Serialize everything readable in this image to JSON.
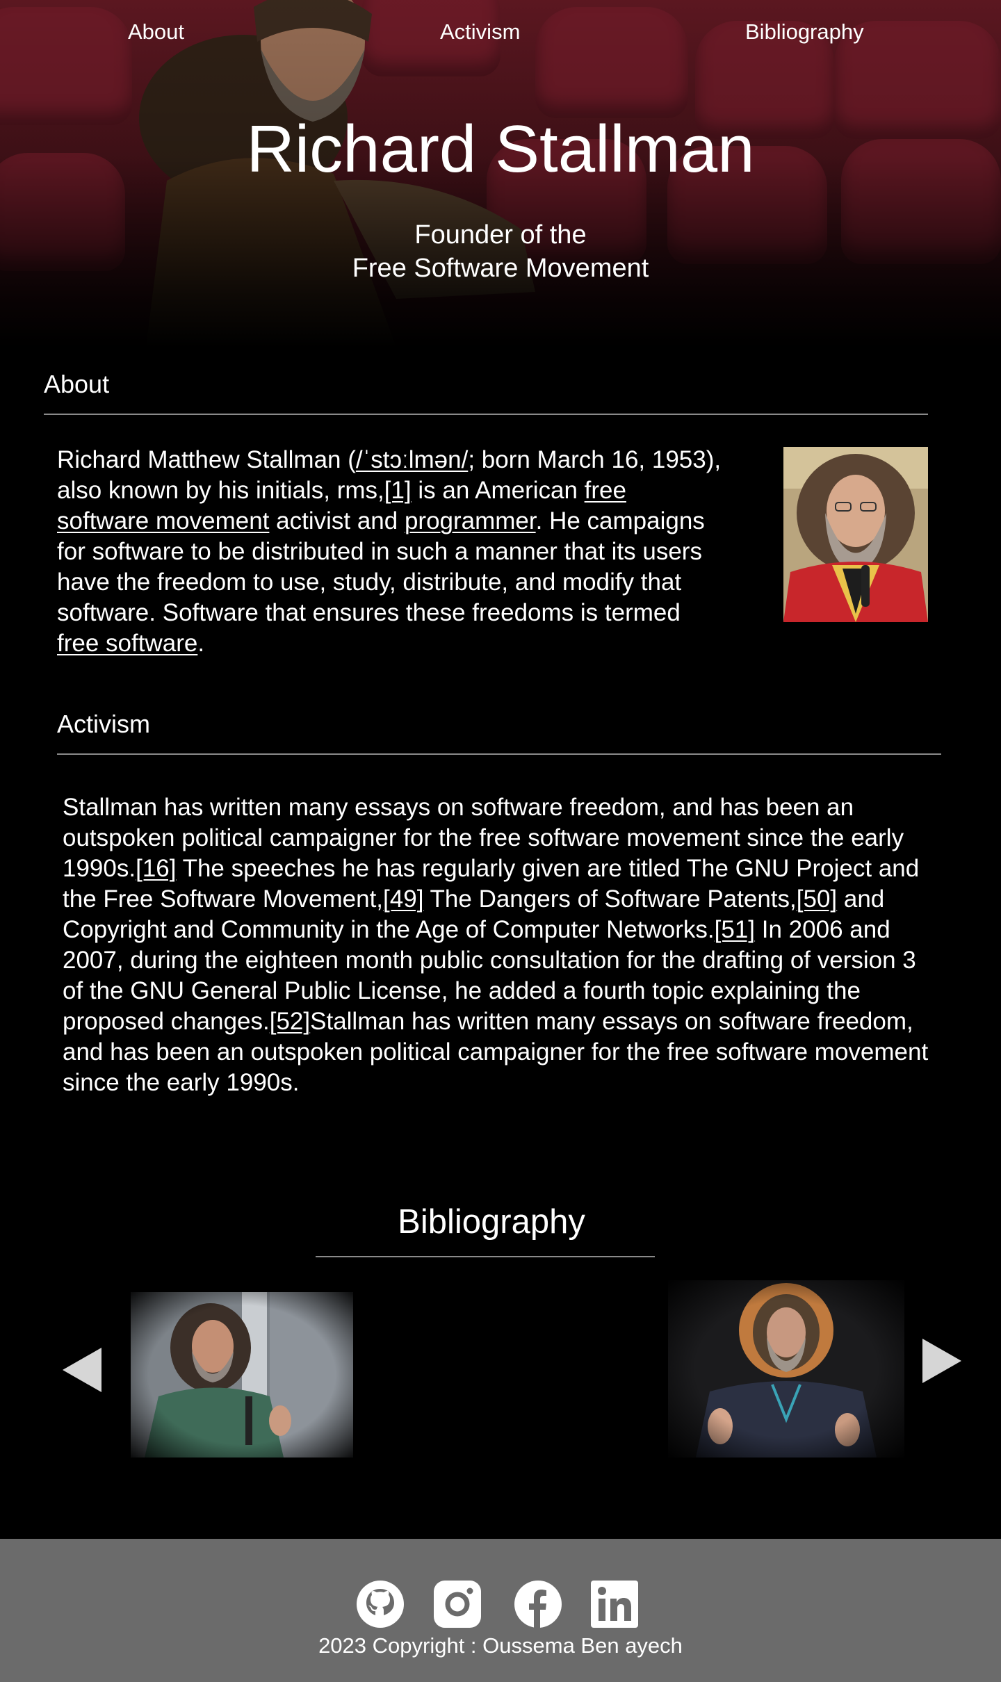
{
  "nav": {
    "about": "About",
    "activism": "Activism",
    "bibliography": "Bibliography"
  },
  "hero": {
    "title": "Richard Stallman",
    "subtitle_line1": "Founder of the",
    "subtitle_line2": "Free Software Movement"
  },
  "about": {
    "heading": "About",
    "t1": "Richard Matthew Stallman (",
    "ipa": "/ˈstɔːlmən/",
    "t2": "; born March 16, 1953), also known by his initials, rms,",
    "ref1": "[1]",
    "t3": " is an American ",
    "link_fsm": "free software movement",
    "t4": " activist and ",
    "link_programmer": "programmer",
    "t5": ". He campaigns for software to be distributed in such a manner that its users have the freedom to use, study, distribute, and modify that software. Software that ensures these freedoms is termed ",
    "link_free_software": "free software",
    "t6": "."
  },
  "activism": {
    "heading": "Activism",
    "t1": "Stallman has written many essays on software freedom, and has been an outspoken political campaigner for the free software movement since the early 1990s.",
    "ref16": "[16]",
    "t2": " The speeches he has regularly given are titled The GNU Project and the Free Software Movement,",
    "ref49": "[49]",
    "t3": " The Dangers of Software Patents,",
    "ref50": "[50]",
    "t4": " and Copyright and Community in the Age of Computer Networks.",
    "ref51": "[51]",
    "t5": " In 2006 and 2007, during the eighteen month public consultation for the drafting of version 3 of the GNU General Public License, he added a fourth topic explaining the proposed changes.",
    "ref52": "[52]",
    "t6": "Stallman has written many essays on software freedom, and has been an outspoken political campaigner for the free software movement since the early 1990s."
  },
  "bibliography": {
    "heading": "Bibliography"
  },
  "footer": {
    "copyright": "2023 Copyright : Oussema Ben ayech",
    "icons": [
      "github-icon",
      "instagram-icon",
      "facebook-icon",
      "linkedin-icon"
    ]
  },
  "colors": {
    "background": "#000000",
    "footer": "#6b6b6b",
    "rule": "#8a8a8a",
    "seat": "#8c2232"
  }
}
